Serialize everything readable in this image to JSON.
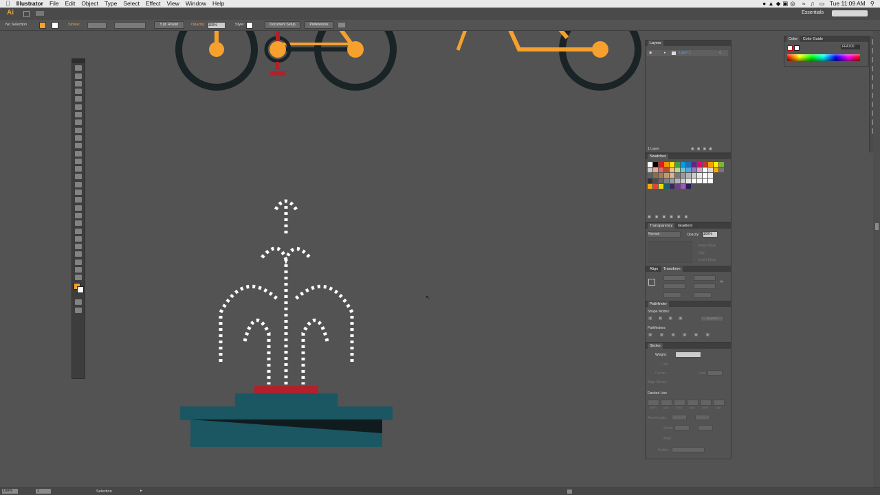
{
  "menubar": {
    "apple_icon": "apple-icon",
    "app_name": "Illustrator",
    "menus": [
      "File",
      "Edit",
      "Object",
      "Type",
      "Select",
      "Effect",
      "View",
      "Window",
      "Help"
    ],
    "clock": "Tue 11:09 AM"
  },
  "appbar": {
    "logo": "Ai",
    "workspace": "Essentials"
  },
  "controlbar": {
    "selection": "No Selection",
    "stroke_label": "Stroke:",
    "brush": "5 pt. Round",
    "opacity_label": "Opacity:",
    "opacity_value": "100%",
    "style_label": "Style:",
    "document_setup": "Document Setup",
    "preferences": "Preferences"
  },
  "layers": {
    "title": "Layers",
    "layer_name": "Layer 1",
    "count": "1 Layer"
  },
  "color": {
    "tabs": [
      "Color",
      "Color Guide"
    ],
    "hex": "FFA700"
  },
  "swatches": {
    "title": "Swatches",
    "colors": [
      [
        "#ffffff",
        "#000000",
        "#e5191e",
        "#f29400",
        "#fce300",
        "#3fa535",
        "#009fe3",
        "#1d70b7",
        "#662483",
        "#e5007e",
        "#c0392b",
        "#f59f00",
        "#fff200",
        "#7ab929"
      ],
      [
        "#c8c8c8",
        "#f4a582",
        "#dd6a6a",
        "#b5502e",
        "#f0c27b",
        "#b8d985",
        "#73c6c9",
        "#5fa3d0",
        "#8e7cc3",
        "#d6a4c7",
        "#ffffff",
        "#d9d9d9",
        "#ffa700",
        "#777777"
      ],
      [
        "#606060",
        "#8c6d46",
        "#a57c52",
        "#c49a6c",
        "#d9b38c",
        "#777777",
        "#999999",
        "#b3b3b3",
        "#cccccc",
        "#e6e6e6",
        "#ffffff",
        "#f2f2f2"
      ],
      [
        "#333333",
        "#4d4d4d",
        "#666666",
        "#808080",
        "#999999",
        "#b3b3b3",
        "#cccccc",
        "#e6e6e6",
        "#ffffff",
        "#f7f7f7",
        "#ffffff",
        "#ffffff"
      ],
      [
        "#ffa700",
        "#e53f3f",
        "#f2d600",
        "#1d5f6e",
        "#3a2a5a",
        "#6d3f8a",
        "#9b59b6",
        "#2a1c4d"
      ]
    ]
  },
  "transparency": {
    "tabs": [
      "Transparency",
      "Gradient"
    ],
    "mode": "Normal",
    "opacity_label": "Opacity:",
    "opacity_value": "100%",
    "make_mask": "Make Mask",
    "clip": "Clip",
    "invert_mask": "Invert Mask"
  },
  "transform": {
    "tabs": [
      "Align",
      "Transform"
    ]
  },
  "pathfinder": {
    "title": "Pathfinder",
    "shape_modes": "Shape Modes:",
    "pathfinders": "Pathfinders:",
    "expand": "Expand"
  },
  "stroke": {
    "title": "Stroke",
    "weight_label": "Weight:",
    "cap": "Cap:",
    "corner": "Corner:",
    "limit": "Limit:",
    "align_stroke": "Align Stroke:",
    "dashed_line": "Dashed Line",
    "dash_labels": [
      "dash",
      "gap",
      "dash",
      "gap",
      "dash",
      "gap"
    ],
    "arrowheads": "Arrowheads:",
    "scale": "Scale:",
    "align": "Align:",
    "profile": "Profile:"
  },
  "statusbar": {
    "zoom": "100%",
    "page": "1",
    "tool": "Selection"
  },
  "colors": {
    "orange": "#f6a12e",
    "bike_dark": "#1a2325",
    "red": "#b1212b",
    "teal": "#1b5663",
    "teal_dark": "#101b1e",
    "white": "#ffffff",
    "canvas": "#535353"
  }
}
